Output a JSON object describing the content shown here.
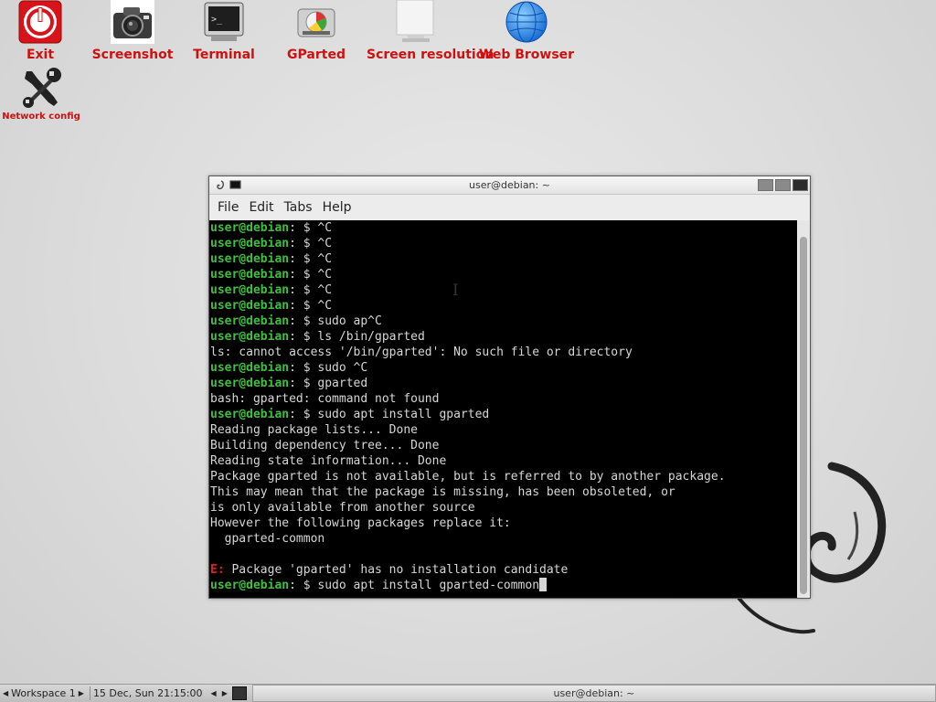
{
  "desktop": {
    "icons": [
      {
        "label": "Exit",
        "icon": "power-icon"
      },
      {
        "label": "Screenshot",
        "icon": "camera-icon"
      },
      {
        "label": "Terminal",
        "icon": "terminal-icon"
      },
      {
        "label": "GParted",
        "icon": "disk-icon"
      },
      {
        "label": "Screen resolution",
        "icon": "monitor-icon"
      },
      {
        "label": "Web Browser",
        "icon": "globe-icon"
      },
      {
        "label": "Network config",
        "icon": "tools-icon"
      }
    ]
  },
  "terminal": {
    "title": "user@debian: ~",
    "menu": [
      "File",
      "Edit",
      "Tabs",
      "Help"
    ],
    "prompt_user": "user@debian",
    "lines": [
      {
        "type": "prompt",
        "cmd": "^C"
      },
      {
        "type": "prompt",
        "cmd": "^C"
      },
      {
        "type": "prompt",
        "cmd": "^C"
      },
      {
        "type": "prompt",
        "cmd": "^C"
      },
      {
        "type": "prompt",
        "cmd": "^C"
      },
      {
        "type": "prompt",
        "cmd": "^C"
      },
      {
        "type": "prompt",
        "cmd": "sudo ap^C"
      },
      {
        "type": "prompt",
        "cmd": "ls /bin/gparted"
      },
      {
        "type": "out",
        "text": "ls: cannot access '/bin/gparted': No such file or directory"
      },
      {
        "type": "prompt",
        "cmd": "sudo ^C"
      },
      {
        "type": "prompt",
        "cmd": "gparted"
      },
      {
        "type": "out",
        "text": "bash: gparted: command not found"
      },
      {
        "type": "prompt",
        "cmd": "sudo apt install gparted"
      },
      {
        "type": "out",
        "text": "Reading package lists... Done"
      },
      {
        "type": "out",
        "text": "Building dependency tree... Done"
      },
      {
        "type": "out",
        "text": "Reading state information... Done"
      },
      {
        "type": "out",
        "text": "Package gparted is not available, but is referred to by another package."
      },
      {
        "type": "out",
        "text": "This may mean that the package is missing, has been obsoleted, or"
      },
      {
        "type": "out",
        "text": "is only available from another source"
      },
      {
        "type": "out",
        "text": "However the following packages replace it:"
      },
      {
        "type": "out",
        "text": "  gparted-common"
      },
      {
        "type": "out",
        "text": ""
      },
      {
        "type": "error",
        "prefix": "E:",
        "text": " Package 'gparted' has no installation candidate"
      },
      {
        "type": "prompt",
        "cmd": "sudo apt install gparted-common",
        "cursor": true
      }
    ]
  },
  "taskbar": {
    "workspace": "Workspace 1",
    "clock": "15 Dec, Sun 21:15:00",
    "task_title": "user@debian: ~"
  },
  "colors": {
    "icon_label": "#cc1111",
    "prompt": "#3fbf3f",
    "error": "#e02020"
  }
}
